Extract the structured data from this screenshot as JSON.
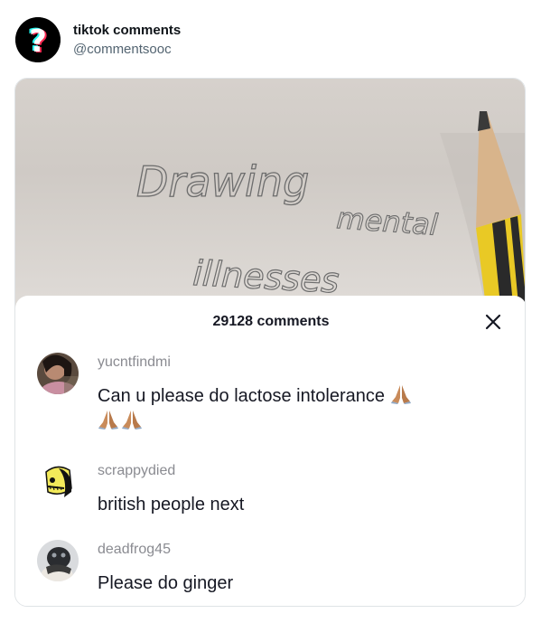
{
  "post": {
    "display_name": "tiktok comments",
    "handle": "@commentsooc",
    "avatar_icon": "question-mark-icon"
  },
  "photo": {
    "handwriting_line1": "Drawing",
    "handwriting_line1b": "mental",
    "handwriting_line2": "illnesses"
  },
  "comments_panel": {
    "title": "29128 comments",
    "close_icon": "close-icon",
    "comments": [
      {
        "username": "yucntfindmi",
        "text": "Can u please do lactose intolerance",
        "emoji": "folded-hands-icon"
      },
      {
        "username": "scrappydied",
        "text": "british people next"
      },
      {
        "username": "deadfrog45",
        "text": "Please do ginger"
      }
    ]
  },
  "colors": {
    "brand_cyan": "#25f4ee",
    "brand_red": "#fe2c55",
    "muted_text": "#8a8b91",
    "handle_text": "#536471"
  }
}
